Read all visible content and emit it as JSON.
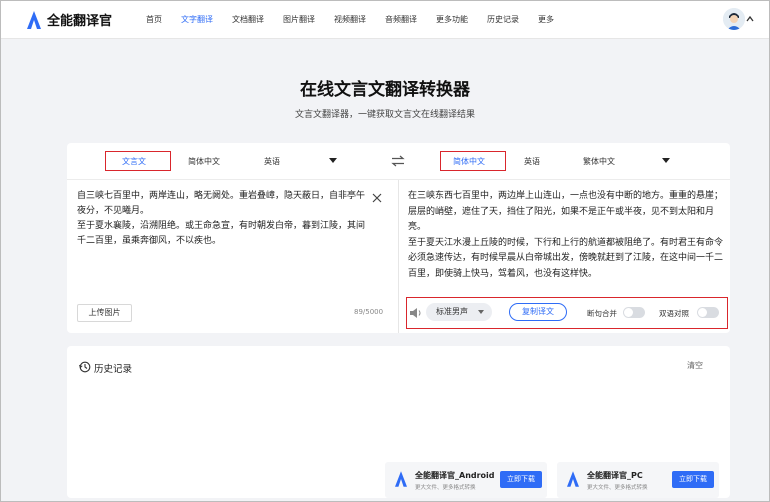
{
  "header": {
    "logo_text": "全能翻译官",
    "nav": [
      {
        "label": "首页",
        "active": false
      },
      {
        "label": "文字翻译",
        "active": true
      },
      {
        "label": "文档翻译",
        "active": false
      },
      {
        "label": "图片翻译",
        "active": false
      },
      {
        "label": "视频翻译",
        "active": false
      },
      {
        "label": "音频翻译",
        "active": false
      },
      {
        "label": "更多功能",
        "active": false
      },
      {
        "label": "历史记录",
        "active": false
      },
      {
        "label": "更多",
        "active": false
      }
    ]
  },
  "hero": {
    "title": "在线文言文翻译转换器",
    "subtitle": "文言文翻译器，一键获取文言文在线翻译结果"
  },
  "translator": {
    "source_langs": [
      "文言文",
      "简体中文",
      "英语"
    ],
    "target_langs": [
      "简体中文",
      "英语",
      "繁体中文"
    ],
    "source_text": "自三峡七百里中，两岸连山，略无阙处。重岩叠嶂，隐天蔽日，自非亭午夜分，不见曦月。\n至于夏水襄陵，沿溯阻绝。或王命急宣，有时朝发白帝，暮到江陵，其间千二百里，虽乘奔御风，不以疾也。",
    "char_count": "89/5000",
    "upload_label": "上传图片",
    "target_text": "在三峡东西七百里中，两边岸上山连山，一点也没有中断的地方。重重的悬崖；层层的峭壁，遮住了天，挡住了阳光，如果不是正午或半夜，见不到太阳和月亮。\n至于夏天江水漫上丘陵的时候，下行和上行的航道都被阻绝了。有时君王有命令必须急速传达，有时候早晨从白帝城出发，傍晚就赶到了江陵，在这中间一千二百里，即使骑上快马，驾着风，也没有这样快。",
    "voice": "标准男声",
    "copy_label": "复制译文",
    "toggle_1": "断句合并",
    "toggle_2": "双语对照"
  },
  "history": {
    "title": "历史记录",
    "clear_label": "清空"
  },
  "promos": [
    {
      "name": "全能翻译官_Android",
      "desc": "更大文件、更多格式转换",
      "button": "立即下载"
    },
    {
      "name": "全能翻译官_PC",
      "desc": "更大文件、更多格式转换",
      "button": "立即下载"
    }
  ],
  "colors": {
    "accent": "#2f6cf6",
    "highlight_box": "#d9262c"
  }
}
